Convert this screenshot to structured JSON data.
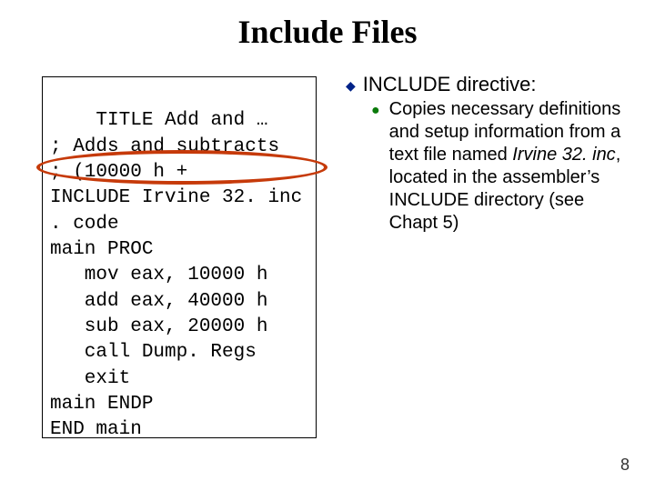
{
  "title": "Include Files",
  "code": {
    "lines": [
      "TITLE Add and …",
      "; Adds and subtracts",
      "; (10000 h +",
      "INCLUDE Irvine 32. inc",
      ". code",
      "main PROC",
      "   mov eax, 10000 h",
      "   add eax, 40000 h",
      "   sub eax, 20000 h",
      "   call Dump. Regs",
      "   exit",
      "main ENDP",
      "END main"
    ]
  },
  "right": {
    "heading": "INCLUDE directive:",
    "sub_before": "Copies necessary definitions and setup information from a text file named ",
    "sub_italic": "Irvine 32. inc",
    "sub_after": ", located in the assembler’s INCLUDE directory (see Chapt 5)"
  },
  "page_number": "8"
}
